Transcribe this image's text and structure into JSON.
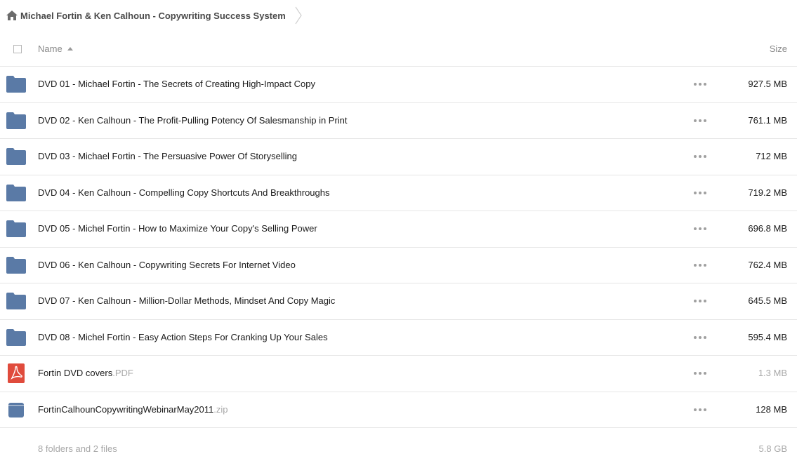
{
  "breadcrumb": {
    "home_icon": "home-icon",
    "title": "Michael Fortin & Ken Calhoun - Copywriting Success System"
  },
  "header": {
    "name_label": "Name",
    "size_label": "Size",
    "sort": "ascending"
  },
  "colors": {
    "folder": "#5a7aa6",
    "pdf": "#e04b3c",
    "zip": "#5a7aa6",
    "divider": "#e6e6e6",
    "muted_text": "#a8a8a8"
  },
  "items": [
    {
      "type": "folder",
      "icon": "folder-icon",
      "name": "DVD 01 - Michael Fortin - The Secrets of Creating High-Impact Copy",
      "ext": "",
      "size": "927.5 MB"
    },
    {
      "type": "folder",
      "icon": "folder-icon",
      "name": "DVD 02 - Ken Calhoun - The Profit-Pulling Potency Of Salesmanship in Print",
      "ext": "",
      "size": "761.1 MB"
    },
    {
      "type": "folder",
      "icon": "folder-icon",
      "name": "DVD 03 - Michael Fortin - The Persuasive Power Of Storyselling",
      "ext": "",
      "size": "712 MB"
    },
    {
      "type": "folder",
      "icon": "folder-icon",
      "name": "DVD 04 - Ken Calhoun - Compelling Copy Shortcuts And Breakthroughs",
      "ext": "",
      "size": "719.2 MB"
    },
    {
      "type": "folder",
      "icon": "folder-icon",
      "name": "DVD 05 - Michel Fortin - How to Maximize Your Copy's Selling Power",
      "ext": "",
      "size": "696.8 MB"
    },
    {
      "type": "folder",
      "icon": "folder-icon",
      "name": "DVD 06 - Ken Calhoun - Copywriting Secrets For Internet Video",
      "ext": "",
      "size": "762.4 MB"
    },
    {
      "type": "folder",
      "icon": "folder-icon",
      "name": "DVD 07 - Ken Calhoun - Million-Dollar Methods, Mindset And Copy Magic",
      "ext": "",
      "size": "645.5 MB"
    },
    {
      "type": "folder",
      "icon": "folder-icon",
      "name": "DVD 08 - Michel Fortin - Easy Action Steps For Cranking Up Your Sales",
      "ext": "",
      "size": "595.4 MB"
    },
    {
      "type": "pdf",
      "icon": "pdf-icon",
      "name": "Fortin DVD covers",
      "ext": ".PDF",
      "size": "1.3 MB"
    },
    {
      "type": "zip",
      "icon": "archive-icon",
      "name": "FortinCalhounCopywritingWebinarMay2011",
      "ext": ".zip",
      "size": "128 MB"
    }
  ],
  "footer": {
    "summary": "8 folders and 2 files",
    "total": "5.8 GB"
  }
}
